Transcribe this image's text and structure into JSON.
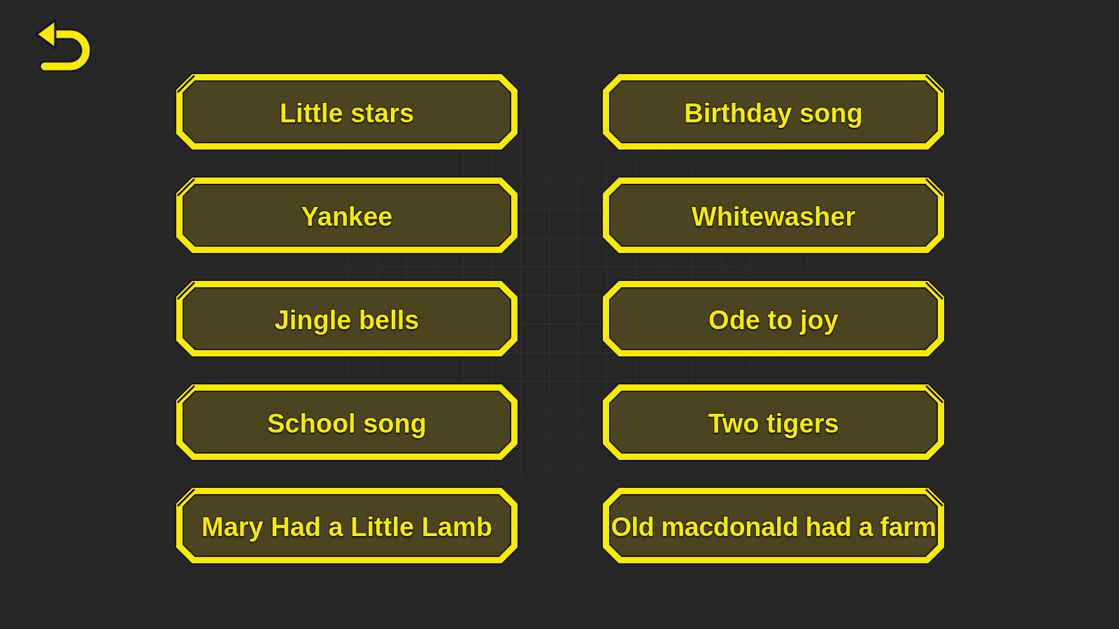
{
  "back_button": {
    "kind": "back"
  },
  "songs": [
    "Little stars",
    "Birthday song",
    "Yankee",
    "Whitewasher",
    "Jingle bells",
    "Ode to joy",
    "School song",
    "Two tigers",
    "Mary Had a Little Lamb",
    "Old macdonald had a farm"
  ]
}
